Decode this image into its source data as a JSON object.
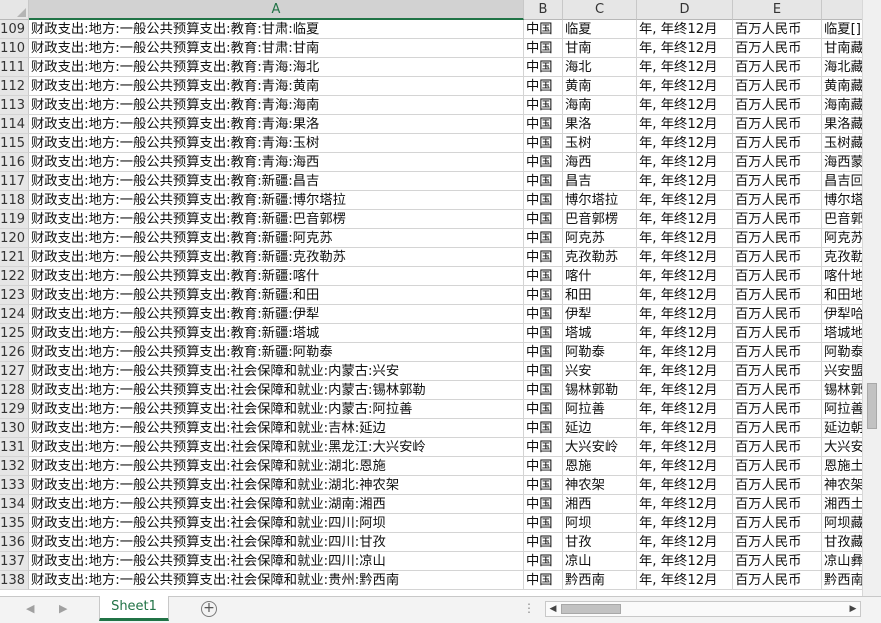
{
  "columns": [
    {
      "label": "A",
      "active": true
    },
    {
      "label": "B",
      "active": false
    },
    {
      "label": "C",
      "active": false
    },
    {
      "label": "D",
      "active": false
    },
    {
      "label": "E",
      "active": false
    },
    {
      "label": "",
      "active": false
    }
  ],
  "rows": [
    {
      "n": "109",
      "a": "财政支出:地方:一般公共预算支出:教育:甘肃:临夏",
      "b": "中国",
      "c": "临夏",
      "d": "年, 年终12月",
      "e": "百万人民币",
      "f": "临夏[]"
    },
    {
      "n": "110",
      "a": "财政支出:地方:一般公共预算支出:教育:甘肃:甘南",
      "b": "中国",
      "c": "甘南",
      "d": "年, 年终12月",
      "e": "百万人民币",
      "f": "甘南藏"
    },
    {
      "n": "111",
      "a": "财政支出:地方:一般公共预算支出:教育:青海:海北",
      "b": "中国",
      "c": "海北",
      "d": "年, 年终12月",
      "e": "百万人民币",
      "f": "海北藏"
    },
    {
      "n": "112",
      "a": "财政支出:地方:一般公共预算支出:教育:青海:黄南",
      "b": "中国",
      "c": "黄南",
      "d": "年, 年终12月",
      "e": "百万人民币",
      "f": "黄南藏"
    },
    {
      "n": "113",
      "a": "财政支出:地方:一般公共预算支出:教育:青海:海南",
      "b": "中国",
      "c": "海南",
      "d": "年, 年终12月",
      "e": "百万人民币",
      "f": "海南藏"
    },
    {
      "n": "114",
      "a": "财政支出:地方:一般公共预算支出:教育:青海:果洛",
      "b": "中国",
      "c": "果洛",
      "d": "年, 年终12月",
      "e": "百万人民币",
      "f": "果洛藏"
    },
    {
      "n": "115",
      "a": "财政支出:地方:一般公共预算支出:教育:青海:玉树",
      "b": "中国",
      "c": "玉树",
      "d": "年, 年终12月",
      "e": "百万人民币",
      "f": "玉树藏"
    },
    {
      "n": "116",
      "a": "财政支出:地方:一般公共预算支出:教育:青海:海西",
      "b": "中国",
      "c": "海西",
      "d": "年, 年终12月",
      "e": "百万人民币",
      "f": "海西蒙"
    },
    {
      "n": "117",
      "a": "财政支出:地方:一般公共预算支出:教育:新疆:昌吉",
      "b": "中国",
      "c": "昌吉",
      "d": "年, 年终12月",
      "e": "百万人民币",
      "f": "昌吉回"
    },
    {
      "n": "118",
      "a": "财政支出:地方:一般公共预算支出:教育:新疆:博尔塔拉",
      "b": "中国",
      "c": "博尔塔拉",
      "d": "年, 年终12月",
      "e": "百万人民币",
      "f": "博尔塔"
    },
    {
      "n": "119",
      "a": "财政支出:地方:一般公共预算支出:教育:新疆:巴音郭楞",
      "b": "中国",
      "c": "巴音郭楞",
      "d": "年, 年终12月",
      "e": "百万人民币",
      "f": "巴音郭"
    },
    {
      "n": "120",
      "a": "财政支出:地方:一般公共预算支出:教育:新疆:阿克苏",
      "b": "中国",
      "c": "阿克苏",
      "d": "年, 年终12月",
      "e": "百万人民币",
      "f": "阿克苏"
    },
    {
      "n": "121",
      "a": "财政支出:地方:一般公共预算支出:教育:新疆:克孜勒苏",
      "b": "中国",
      "c": "克孜勒苏",
      "d": "年, 年终12月",
      "e": "百万人民币",
      "f": "克孜勒"
    },
    {
      "n": "122",
      "a": "财政支出:地方:一般公共预算支出:教育:新疆:喀什",
      "b": "中国",
      "c": "喀什",
      "d": "年, 年终12月",
      "e": "百万人民币",
      "f": "喀什地"
    },
    {
      "n": "123",
      "a": "财政支出:地方:一般公共预算支出:教育:新疆:和田",
      "b": "中国",
      "c": "和田",
      "d": "年, 年终12月",
      "e": "百万人民币",
      "f": "和田地"
    },
    {
      "n": "124",
      "a": "财政支出:地方:一般公共预算支出:教育:新疆:伊犁",
      "b": "中国",
      "c": "伊犁",
      "d": "年, 年终12月",
      "e": "百万人民币",
      "f": "伊犁哈"
    },
    {
      "n": "125",
      "a": "财政支出:地方:一般公共预算支出:教育:新疆:塔城",
      "b": "中国",
      "c": "塔城",
      "d": "年, 年终12月",
      "e": "百万人民币",
      "f": "塔城地"
    },
    {
      "n": "126",
      "a": "财政支出:地方:一般公共预算支出:教育:新疆:阿勒泰",
      "b": "中国",
      "c": "阿勒泰",
      "d": "年, 年终12月",
      "e": "百万人民币",
      "f": "阿勒泰"
    },
    {
      "n": "127",
      "a": "财政支出:地方:一般公共预算支出:社会保障和就业:内蒙古:兴安",
      "b": "中国",
      "c": "兴安",
      "d": "年, 年终12月",
      "e": "百万人民币",
      "f": "兴安盟"
    },
    {
      "n": "128",
      "a": "财政支出:地方:一般公共预算支出:社会保障和就业:内蒙古:锡林郭勒",
      "b": "中国",
      "c": "锡林郭勒",
      "d": "年, 年终12月",
      "e": "百万人民币",
      "f": "锡林郭"
    },
    {
      "n": "129",
      "a": "财政支出:地方:一般公共预算支出:社会保障和就业:内蒙古:阿拉善",
      "b": "中国",
      "c": "阿拉善",
      "d": "年, 年终12月",
      "e": "百万人民币",
      "f": "阿拉善"
    },
    {
      "n": "130",
      "a": "财政支出:地方:一般公共预算支出:社会保障和就业:吉林:延边",
      "b": "中国",
      "c": "延边",
      "d": "年, 年终12月",
      "e": "百万人民币",
      "f": "延边朝"
    },
    {
      "n": "131",
      "a": "财政支出:地方:一般公共预算支出:社会保障和就业:黑龙江:大兴安岭",
      "b": "中国",
      "c": "大兴安岭",
      "d": "年, 年终12月",
      "e": "百万人民币",
      "f": "大兴安"
    },
    {
      "n": "132",
      "a": "财政支出:地方:一般公共预算支出:社会保障和就业:湖北:恩施",
      "b": "中国",
      "c": "恩施",
      "d": "年, 年终12月",
      "e": "百万人民币",
      "f": "恩施土"
    },
    {
      "n": "133",
      "a": "财政支出:地方:一般公共预算支出:社会保障和就业:湖北:神农架",
      "b": "中国",
      "c": "神农架",
      "d": "年, 年终12月",
      "e": "百万人民币",
      "f": "神农架"
    },
    {
      "n": "134",
      "a": "财政支出:地方:一般公共预算支出:社会保障和就业:湖南:湘西",
      "b": "中国",
      "c": "湘西",
      "d": "年, 年终12月",
      "e": "百万人民币",
      "f": "湘西土"
    },
    {
      "n": "135",
      "a": "财政支出:地方:一般公共预算支出:社会保障和就业:四川:阿坝",
      "b": "中国",
      "c": "阿坝",
      "d": "年, 年终12月",
      "e": "百万人民币",
      "f": "阿坝藏"
    },
    {
      "n": "136",
      "a": "财政支出:地方:一般公共预算支出:社会保障和就业:四川:甘孜",
      "b": "中国",
      "c": "甘孜",
      "d": "年, 年终12月",
      "e": "百万人民币",
      "f": "甘孜藏"
    },
    {
      "n": "137",
      "a": "财政支出:地方:一般公共预算支出:社会保障和就业:四川:凉山",
      "b": "中国",
      "c": "凉山",
      "d": "年, 年终12月",
      "e": "百万人民币",
      "f": "凉山彝"
    },
    {
      "n": "138",
      "a": "财政支出:地方:一般公共预算支出:社会保障和就业:贵州:黔西南",
      "b": "中国",
      "c": "黔西南",
      "d": "年, 年终12月",
      "e": "百万人民币",
      "f": "黔西南"
    }
  ],
  "sheet_tab": "Sheet1",
  "add_sheet_symbol": "+",
  "icons": {
    "prev_sheet": "chevron-left-icon",
    "next_sheet": "chevron-right-icon",
    "add_sheet": "plus-circle-icon",
    "scroll_left": "triangle-left-icon",
    "scroll_right": "triangle-right-icon"
  },
  "colors": {
    "accent": "#217346",
    "header_bg": "#e6e6e6",
    "gridline": "#d4d4d4"
  }
}
